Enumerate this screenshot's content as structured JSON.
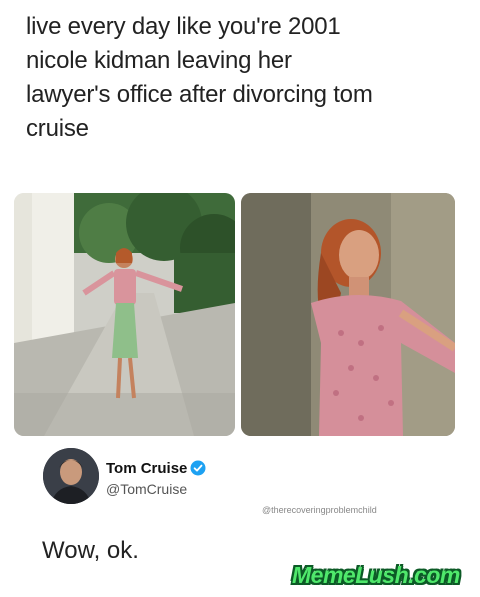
{
  "caption": {
    "lines": [
      "live every day like you're 2001",
      "nicole kidman leaving her",
      "lawyer's office after divorcing tom",
      "cruise"
    ]
  },
  "tweet": {
    "name": "Tom Cruise",
    "handle": "@TomCruise",
    "text": "Wow, ok.",
    "verified": true,
    "verified_color": "#1da1f2"
  },
  "watermark": "@therecoveringproblemchild",
  "site_logo": "MemeLush.com",
  "colors": {
    "logo_fill": "#4fe86b",
    "logo_outline": "#0c5a26"
  }
}
